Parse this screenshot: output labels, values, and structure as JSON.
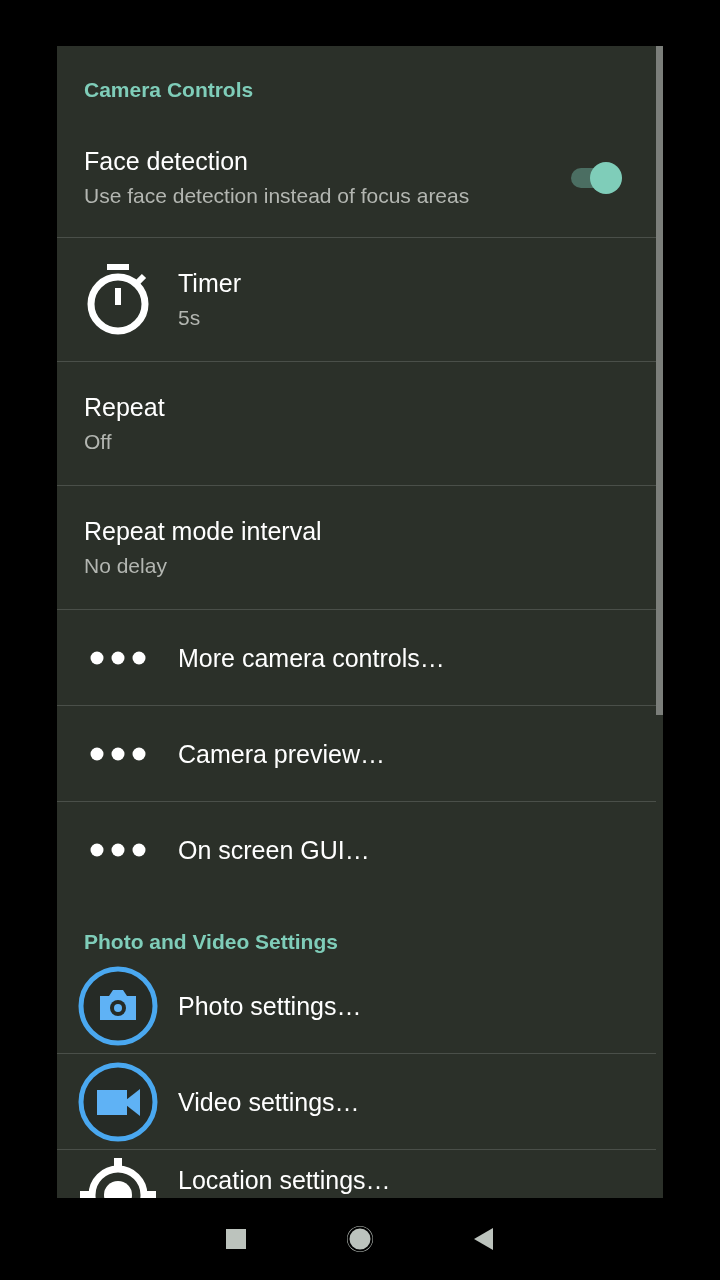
{
  "sections": [
    {
      "title": "Camera Controls",
      "items": [
        {
          "kind": "switch",
          "title": "Face detection",
          "summary": "Use face detection instead of focus areas",
          "on": true
        },
        {
          "kind": "stopwatch",
          "title": "Timer",
          "summary": "5s"
        },
        {
          "kind": "plain",
          "title": "Repeat",
          "summary": "Off"
        },
        {
          "kind": "plain",
          "title": "Repeat mode interval",
          "summary": "No delay"
        },
        {
          "kind": "submenu",
          "title": "More camera controls…"
        },
        {
          "kind": "submenu",
          "title": "Camera preview…"
        },
        {
          "kind": "submenu",
          "title": "On screen GUI…"
        }
      ]
    },
    {
      "title": "Photo and Video Settings",
      "items": [
        {
          "kind": "photo",
          "title": "Photo settings…"
        },
        {
          "kind": "video",
          "title": "Video settings…"
        },
        {
          "kind": "location",
          "title": "Location settings…"
        }
      ]
    }
  ]
}
